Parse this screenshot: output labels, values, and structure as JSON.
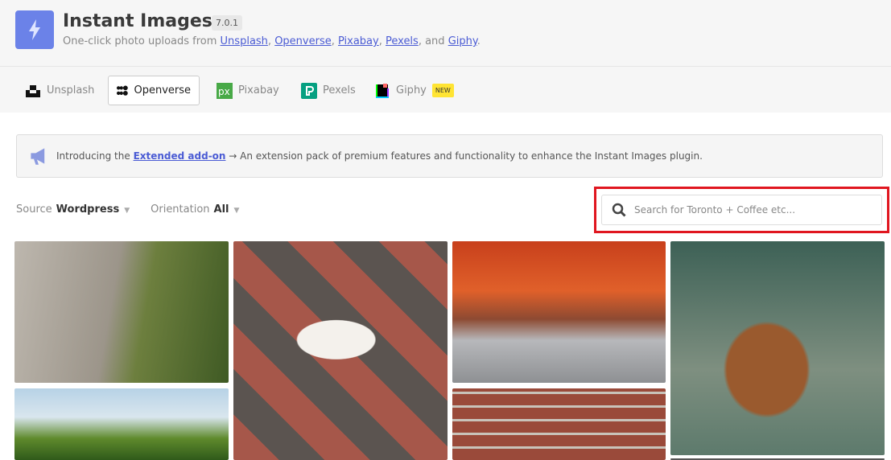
{
  "header": {
    "title": "Instant Images",
    "version": "7.0.1",
    "subtitle_prefix": "One-click photo uploads from ",
    "links": [
      "Unsplash",
      "Openverse",
      "Pixabay",
      "Pexels",
      "Giphy"
    ],
    "and": ", and ",
    "sep": ", ",
    "end": "."
  },
  "tabs": [
    {
      "label": "Unsplash"
    },
    {
      "label": "Openverse"
    },
    {
      "label": "Pixabay"
    },
    {
      "label": "Pexels"
    },
    {
      "label": "Giphy",
      "badge": "NEW"
    }
  ],
  "notice": {
    "prefix": "Introducing the ",
    "link": "Extended add-on",
    "suffix": " → An extension pack of premium features and functionality to enhance the Instant Images plugin."
  },
  "filters": {
    "source_label": "Source",
    "source_value": "Wordpress",
    "orientation_label": "Orientation",
    "orientation_value": "All"
  },
  "search": {
    "placeholder": "Search for Toronto + Coffee etc..."
  },
  "colors": {
    "accent": "#6b82e8",
    "highlight": "#e0161f",
    "link": "#4a5bd4"
  }
}
